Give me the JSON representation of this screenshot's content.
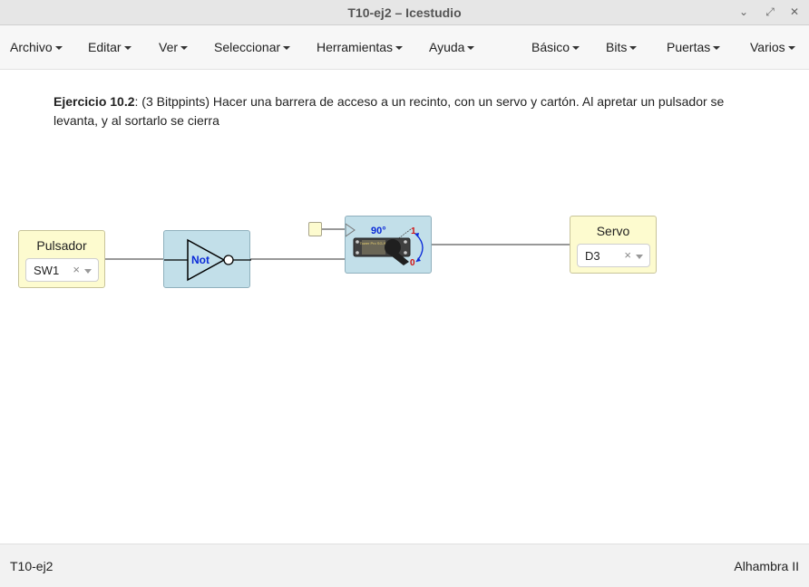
{
  "window": {
    "title": "T10-ej2 – Icestudio",
    "minimize_glyph": "⌄",
    "restore_glyph": "⤢",
    "close_glyph": "✕"
  },
  "menubar": {
    "left": [
      "Archivo",
      "Editar",
      "Ver",
      "Seleccionar",
      "Herramientas",
      "Ayuda"
    ],
    "right": [
      "Básico",
      "Bits",
      "Puertas",
      "Varios"
    ]
  },
  "description": {
    "bold": "Ejercicio 10.2",
    "text": ": (3 Bitppints) Hacer una barrera de acceso a un recinto, con un servo y cartón. Al apretar un pulsador se levanta, y al sortarlo se cierra"
  },
  "blocks": {
    "pulsador": {
      "label": "Pulsador",
      "value": "SW1",
      "clear": "×"
    },
    "not": {
      "label": "Not"
    },
    "servo_module": {
      "angle": "90°",
      "top_value": "1",
      "bottom_value": "0",
      "chip_text": "Tower Pro SG-90"
    },
    "servo": {
      "label": "Servo",
      "value": "D3",
      "clear": "×"
    }
  },
  "statusbar": {
    "project": "T10-ej2",
    "board": "Alhambra II"
  }
}
